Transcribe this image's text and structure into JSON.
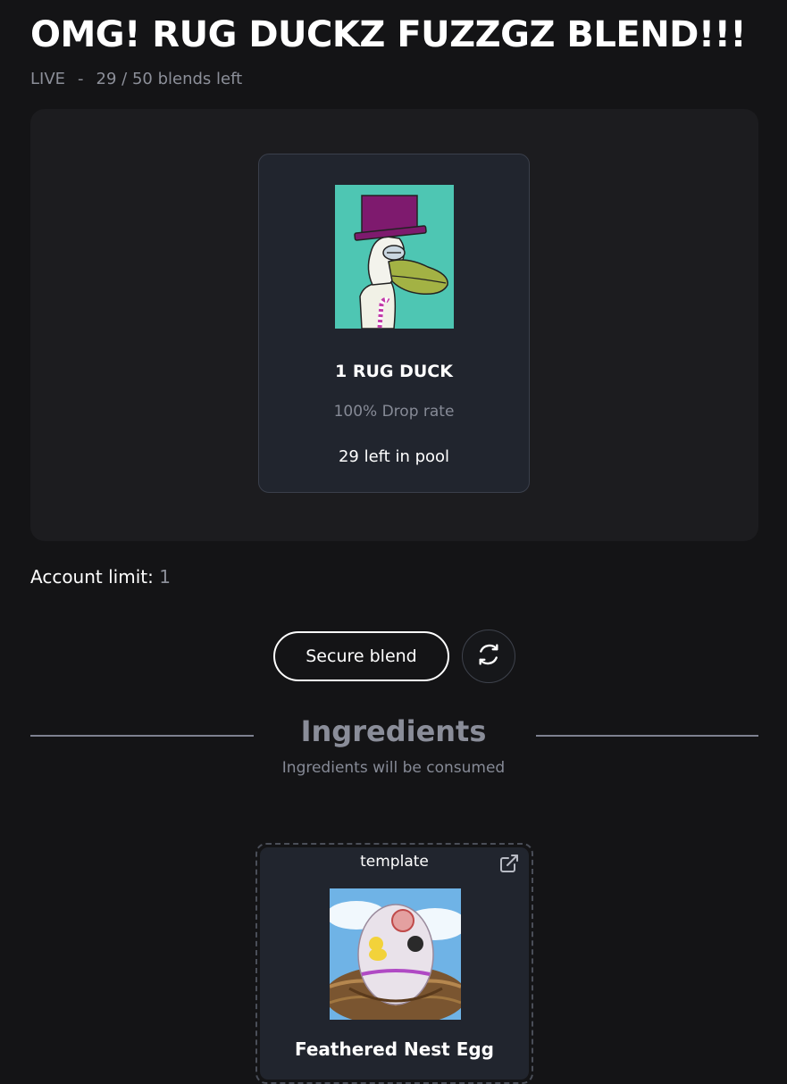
{
  "header": {
    "title": "OMG! RUG DUCKZ FUZZGZ BLEND!!!",
    "status": "LIVE",
    "separator": "-",
    "blends_left": "29 / 50 blends left"
  },
  "result": {
    "name": "1 RUG DUCK",
    "drop_rate": "100% Drop rate",
    "pool_left": "29 left in pool",
    "image": "rug-duck-nft-image"
  },
  "account": {
    "limit_label": "Account limit:",
    "limit_value": "1"
  },
  "actions": {
    "secure_blend_label": "Secure blend",
    "refresh_icon": "refresh-icon"
  },
  "ingredients": {
    "title": "Ingredients",
    "subtitle": "Ingredients will be consumed",
    "items": [
      {
        "type_label": "template",
        "name": "Feathered Nest Egg",
        "image": "feathered-nest-egg-image",
        "link_icon": "external-link-icon"
      }
    ]
  },
  "colors": {
    "background": "#141416",
    "panel": "#1c1c1f",
    "card": "#21252e",
    "muted_text": "#8c8f99",
    "accent_white": "#ffffff"
  }
}
